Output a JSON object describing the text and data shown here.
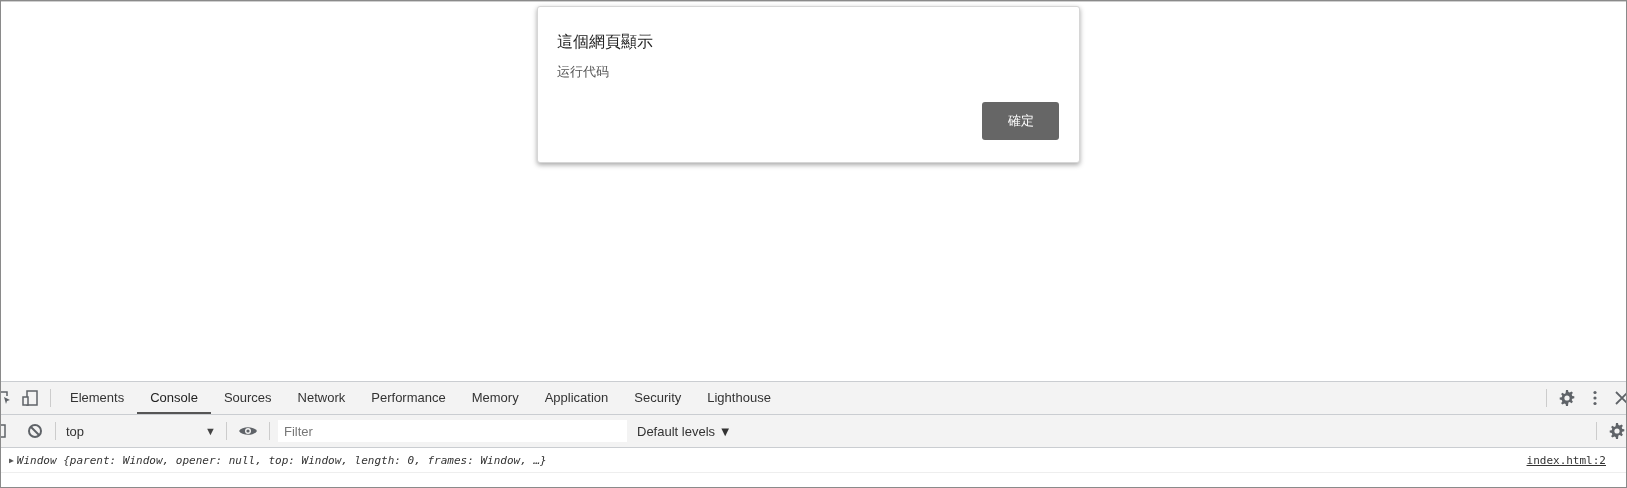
{
  "dialog": {
    "title": "這個網頁顯示",
    "message": "运行代码",
    "button": "確定"
  },
  "devtools": {
    "tabs": [
      {
        "label": "Elements",
        "selected": false
      },
      {
        "label": "Console",
        "selected": true
      },
      {
        "label": "Sources",
        "selected": false
      },
      {
        "label": "Network",
        "selected": false
      },
      {
        "label": "Performance",
        "selected": false
      },
      {
        "label": "Memory",
        "selected": false
      },
      {
        "label": "Application",
        "selected": false
      },
      {
        "label": "Security",
        "selected": false
      },
      {
        "label": "Lighthouse",
        "selected": false
      }
    ],
    "toolbar": {
      "context": "top",
      "context_caret": "▼",
      "filter_placeholder": "Filter",
      "levels": "Default levels ▼"
    },
    "messages": [
      {
        "expand": "▶",
        "text": "Window {parent: Window, opener: null, top: Window, length: 0, frames: Window, …}",
        "source": "index.html:2"
      }
    ]
  }
}
